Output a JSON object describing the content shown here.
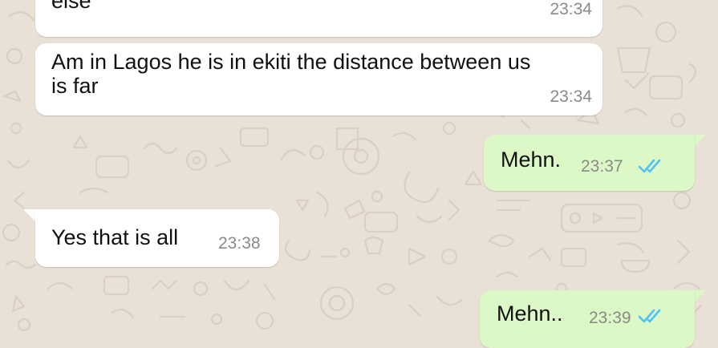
{
  "conversation": {
    "messages": [
      {
        "direction": "incoming",
        "text": "else",
        "time": "23:34"
      },
      {
        "direction": "incoming",
        "text": "Am in Lagos he is in ekiti the distance between us\nis far",
        "time": "23:34"
      },
      {
        "direction": "outgoing",
        "text": "Mehn.",
        "time": "23:37",
        "status": "read"
      },
      {
        "direction": "incoming",
        "text": "Yes that is all",
        "time": "23:38"
      },
      {
        "direction": "outgoing",
        "text": "Mehn..",
        "time": "23:39",
        "status": "read"
      }
    ]
  },
  "colors": {
    "wallpaper": "#e9e1d6",
    "incoming_bubble": "#ffffff",
    "outgoing_bubble": "#dcf8c6",
    "read_tick": "#4fc3f7",
    "timestamp": "#8a8a8a"
  },
  "icons": {
    "read_receipt": "double-check-icon",
    "wallpaper": "chat-doodle-pattern"
  }
}
